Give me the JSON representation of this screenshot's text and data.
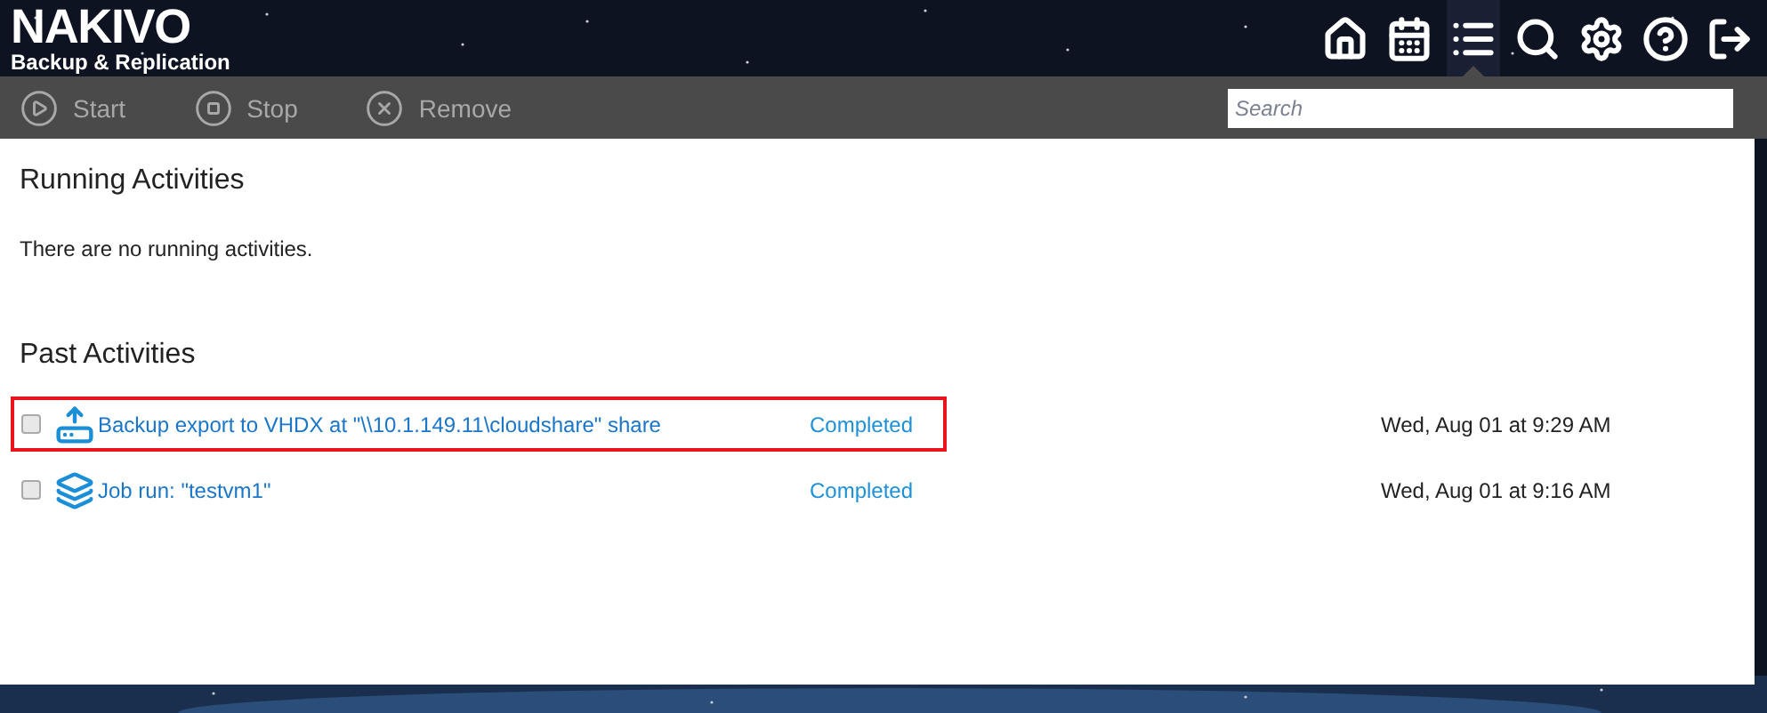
{
  "logo": {
    "title": "NAKIVO",
    "subtitle": "Backup & Replication"
  },
  "nav": [
    {
      "kind": "home",
      "selected": false
    },
    {
      "kind": "calendar",
      "selected": false
    },
    {
      "kind": "activities",
      "selected": true
    },
    {
      "kind": "search",
      "selected": false
    },
    {
      "kind": "settings",
      "selected": false
    },
    {
      "kind": "help",
      "selected": false
    },
    {
      "kind": "logout",
      "selected": false
    }
  ],
  "toolbar": [
    {
      "kind": "start",
      "label": "Start"
    },
    {
      "kind": "stop",
      "label": "Stop"
    },
    {
      "kind": "remove",
      "label": "Remove"
    }
  ],
  "search": {
    "placeholder": "Search"
  },
  "running": {
    "title": "Running Activities",
    "empty_text": "There are no running activities."
  },
  "past": {
    "title": "Past Activities",
    "rows": [
      {
        "kind": "export",
        "name": "Backup export to VHDX at \"\\\\10.1.149.11\\cloudshare\" share",
        "status": "Completed",
        "time": "Wed, Aug 01 at 9:29 AM",
        "checked": false,
        "highlighted": true
      },
      {
        "kind": "job",
        "name": "Job run: \"testvm1\"",
        "status": "Completed",
        "time": "Wed, Aug 01 at 9:16 AM",
        "checked": false,
        "highlighted": false
      }
    ]
  }
}
